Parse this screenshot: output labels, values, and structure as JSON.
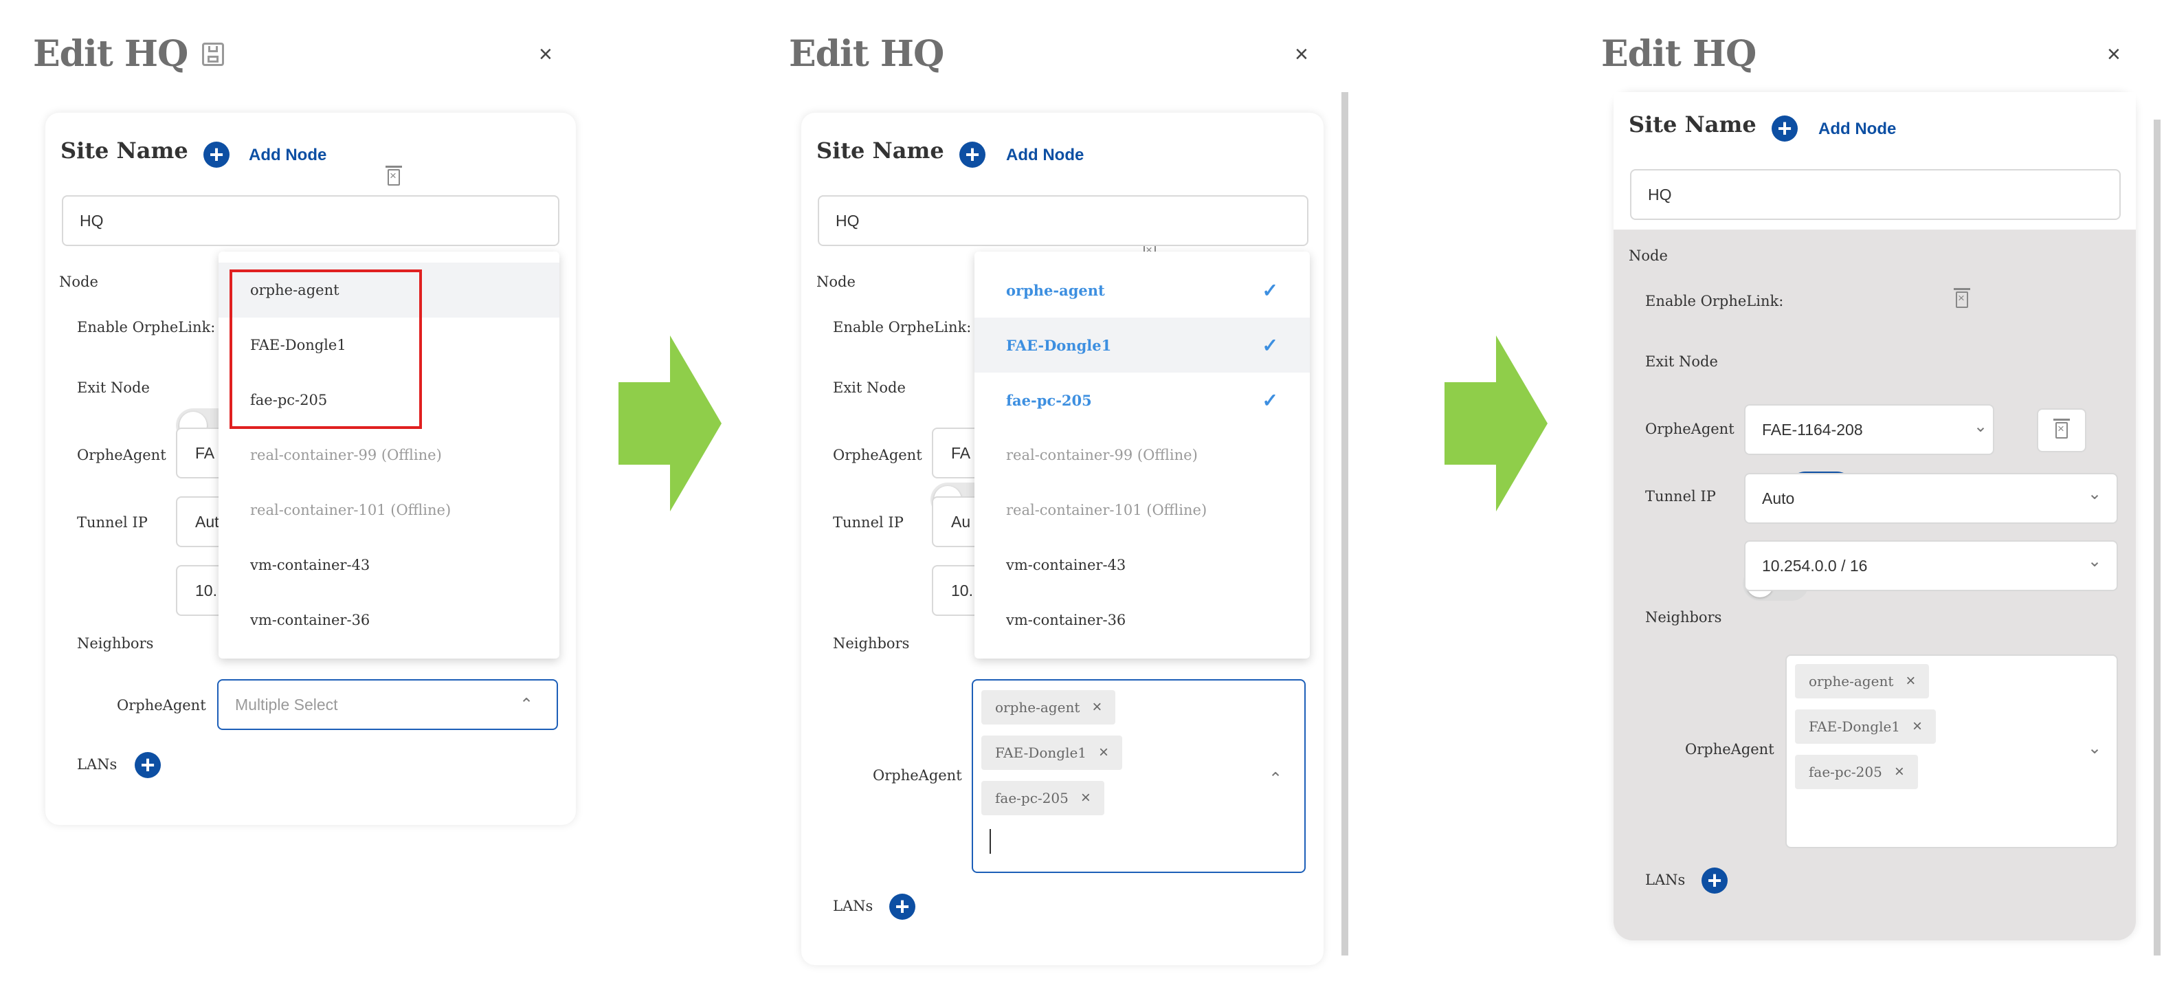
{
  "panel": {
    "title": "Edit HQ",
    "close": "×",
    "site_name_label": "Site Name",
    "add_node_label": "Add Node",
    "site_value": "HQ",
    "node_label": "Node",
    "enable_label": "Enable OrpheLink:",
    "exit_label": "Exit Node",
    "agent_label": "OrpheAgent",
    "tunnel_label": "Tunnel IP",
    "neighbors_label": "Neighbors",
    "neighbors_agent_label": "OrpheAgent",
    "lans_label": "LANs",
    "agent_partial": "FA",
    "tunnel_partial": "Aut",
    "subnet_partial": "10.",
    "tunnel_partial2": "Au",
    "multi_placeholder": "Multiple Select"
  },
  "options": [
    {
      "label": "orphe-agent",
      "state": "online"
    },
    {
      "label": "FAE-Dongle1",
      "state": "online"
    },
    {
      "label": "fae-pc-205",
      "state": "online"
    },
    {
      "label": "real-container-99 (Offline)",
      "state": "offline"
    },
    {
      "label": "real-container-101 (Offline)",
      "state": "offline"
    },
    {
      "label": "vm-container-43",
      "state": "online"
    },
    {
      "label": "vm-container-36",
      "state": "online"
    }
  ],
  "selected_tags": [
    "orphe-agent",
    "FAE-Dongle1",
    "fae-pc-205"
  ],
  "final": {
    "agent_value": "FAE-1164-208",
    "tunnel_value": "Auto",
    "subnet_value": "10.254.0.0 / 16",
    "enable_on": true,
    "exit_on": false
  },
  "icons": {
    "save": "floppy-disk-icon",
    "delete": "trash-icon",
    "add": "plus-circle-icon",
    "check": "check-icon",
    "remove": "close-icon",
    "chevron": "chevron-down-icon"
  },
  "colors": {
    "accent": "#0d4fa3",
    "selected_text": "#3d8fe0",
    "highlight_box": "#e02020",
    "arrow": "#8fce4a",
    "disabled_panel": "#e4e2e2"
  }
}
